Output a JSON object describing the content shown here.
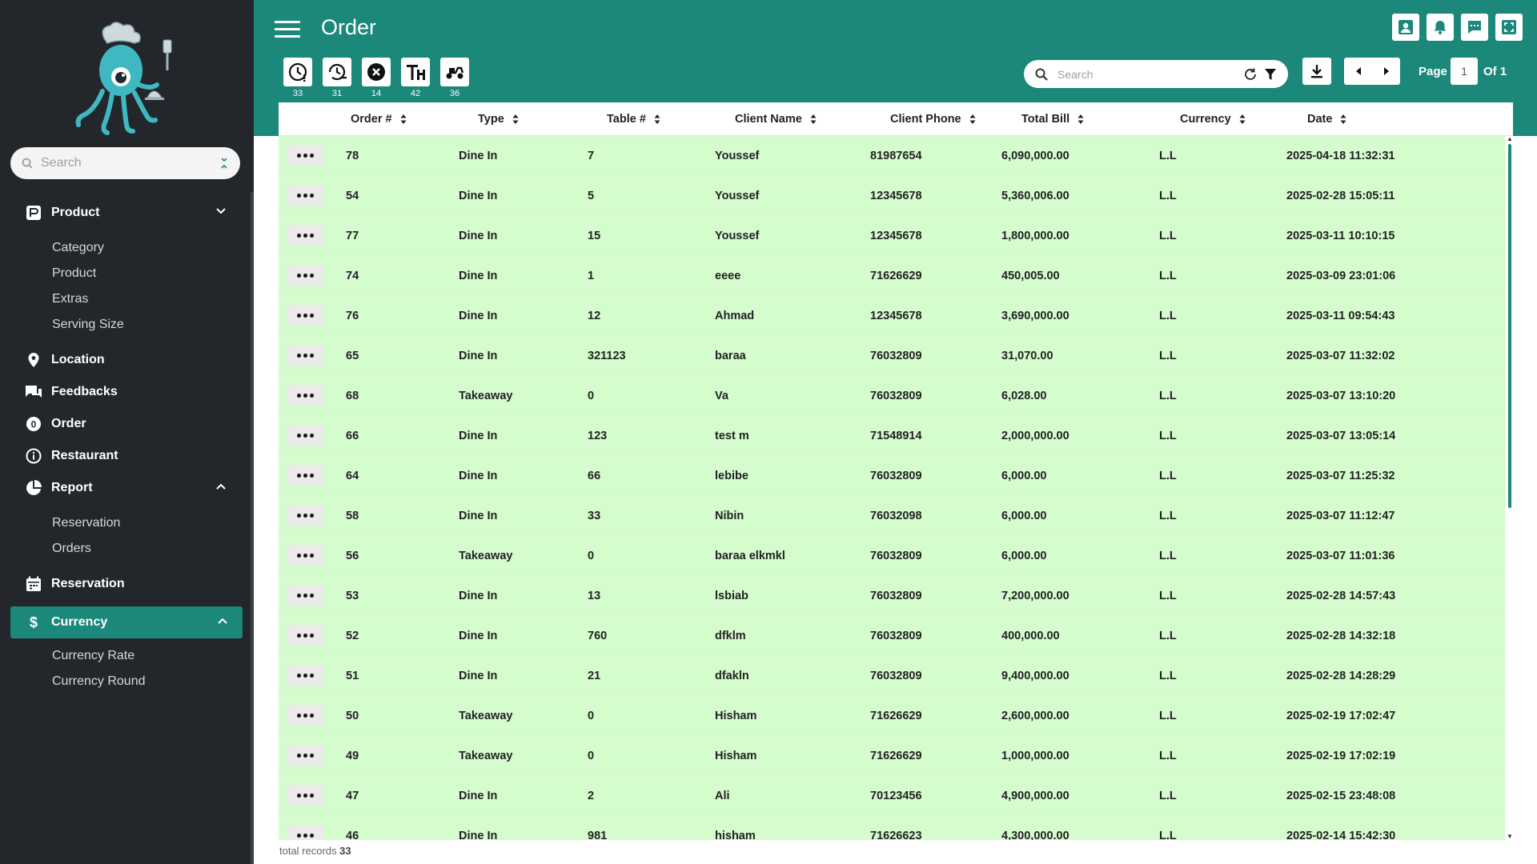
{
  "sidebar": {
    "search_placeholder": "Search",
    "items": [
      {
        "label": "Product",
        "icon": "product-icon",
        "expanded": true,
        "subitems": [
          "Category",
          "Product",
          "Extras",
          "Serving Size"
        ]
      },
      {
        "label": "Location",
        "icon": "location-pin-icon"
      },
      {
        "label": "Feedbacks",
        "icon": "chat-icon"
      },
      {
        "label": "Order",
        "icon": "order-badge-icon",
        "badge": "0"
      },
      {
        "label": "Restaurant",
        "icon": "info-icon"
      },
      {
        "label": "Report",
        "icon": "pie-chart-icon",
        "expanded": true,
        "subitems": [
          "Reservation",
          "Orders"
        ]
      },
      {
        "label": "Reservation",
        "icon": "calendar-icon"
      },
      {
        "label": "Currency",
        "icon": "dollar-icon",
        "active": true,
        "expanded": true,
        "subitems": [
          "Currency Rate",
          "Currency Round"
        ]
      }
    ]
  },
  "header": {
    "title": "Order",
    "top_icons": [
      "user-icon",
      "bell-icon",
      "message-icon",
      "fullscreen-icon"
    ],
    "accent_color": "#1b887a"
  },
  "toolbar": {
    "status_filters": [
      {
        "icon": "pending-clock-icon",
        "count": "33"
      },
      {
        "icon": "history-clock-icon",
        "count": "31"
      },
      {
        "icon": "cancel-icon",
        "count": "14"
      },
      {
        "icon": "dine-in-icon",
        "count": "42"
      },
      {
        "icon": "delivery-icon",
        "count": "36"
      }
    ],
    "search_placeholder": "Search",
    "page_label": "Page",
    "page_value": "1",
    "page_of": "Of 1"
  },
  "table": {
    "columns": [
      "Order #",
      "Type",
      "Table #",
      "Client Name",
      "Client Phone",
      "Total Bill",
      "Currency",
      "Date"
    ],
    "row_color": "#d4fccc",
    "rows": [
      [
        "78",
        "Dine In",
        "7",
        "Youssef",
        "81987654",
        "6,090,000.00",
        "L.L",
        "2025-04-18 11:32:31"
      ],
      [
        "54",
        "Dine In",
        "5",
        "Youssef",
        "12345678",
        "5,360,006.00",
        "L.L",
        "2025-02-28 15:05:11"
      ],
      [
        "77",
        "Dine In",
        "15",
        "Youssef",
        "12345678",
        "1,800,000.00",
        "L.L",
        "2025-03-11 10:10:15"
      ],
      [
        "74",
        "Dine In",
        "1",
        "eeee",
        "71626629",
        "450,005.00",
        "L.L",
        "2025-03-09 23:01:06"
      ],
      [
        "76",
        "Dine In",
        "12",
        "Ahmad",
        "12345678",
        "3,690,000.00",
        "L.L",
        "2025-03-11 09:54:43"
      ],
      [
        "65",
        "Dine In",
        "321123",
        "baraa",
        "76032809",
        "31,070.00",
        "L.L",
        "2025-03-07 11:32:02"
      ],
      [
        "68",
        "Takeaway",
        "0",
        "Va",
        "76032809",
        "6,028.00",
        "L.L",
        "2025-03-07 13:10:20"
      ],
      [
        "66",
        "Dine In",
        "123",
        "test m",
        "71548914",
        "2,000,000.00",
        "L.L",
        "2025-03-07 13:05:14"
      ],
      [
        "64",
        "Dine In",
        "66",
        "lebibe",
        "76032809",
        "6,000.00",
        "L.L",
        "2025-03-07 11:25:32"
      ],
      [
        "58",
        "Dine In",
        "33",
        "Nibin",
        "76032098",
        "6,000.00",
        "L.L",
        "2025-03-07 11:12:47"
      ],
      [
        "56",
        "Takeaway",
        "0",
        "baraa elkmkl",
        "76032809",
        "6,000.00",
        "L.L",
        "2025-03-07 11:01:36"
      ],
      [
        "53",
        "Dine In",
        "13",
        "lsbiab",
        "76032809",
        "7,200,000.00",
        "L.L",
        "2025-02-28 14:57:43"
      ],
      [
        "52",
        "Dine In",
        "760",
        "dfklm",
        "76032809",
        "400,000.00",
        "L.L",
        "2025-02-28 14:32:18"
      ],
      [
        "51",
        "Dine In",
        "21",
        "dfakln",
        "76032809",
        "9,400,000.00",
        "L.L",
        "2025-02-28 14:28:29"
      ],
      [
        "50",
        "Takeaway",
        "0",
        "Hisham",
        "71626629",
        "2,600,000.00",
        "L.L",
        "2025-02-19 17:02:47"
      ],
      [
        "49",
        "Takeaway",
        "0",
        "Hisham",
        "71626629",
        "1,000,000.00",
        "L.L",
        "2025-02-19 17:02:19"
      ],
      [
        "47",
        "Dine In",
        "2",
        "Ali",
        "70123456",
        "4,900,000.00",
        "L.L",
        "2025-02-15 23:48:08"
      ],
      [
        "46",
        "Dine In",
        "981",
        "hisham",
        "71626623",
        "4,300,000.00",
        "L.L",
        "2025-02-14 15:42:30"
      ]
    ]
  },
  "footer": {
    "total_label": "total records",
    "total_value": "33"
  }
}
